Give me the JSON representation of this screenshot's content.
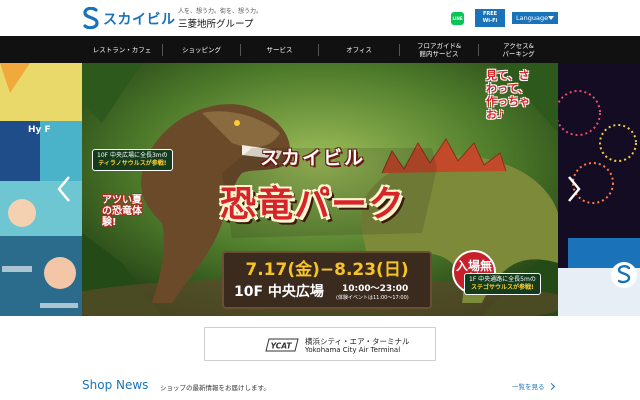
{
  "header": {
    "logo_text": "スカイビル",
    "tagline": "人を、想う力。街を、想う力。",
    "group_name": "三菱地所グループ",
    "line_label": "LINE",
    "wifi_line1": "FREE",
    "wifi_line2": "Wi-Fi",
    "language_label": "Language",
    "brand_color": "#1a73b9"
  },
  "nav": {
    "items": [
      {
        "label": "レストラン・カフェ"
      },
      {
        "label": "ショッピング"
      },
      {
        "label": "サービス"
      },
      {
        "label": "オフィス"
      },
      {
        "label": "フロアガイド&\n館内サービス"
      },
      {
        "label": "アクセス&\nパーキング"
      }
    ]
  },
  "hero": {
    "side_left_text": "Hy F",
    "banner_title_1": "スカイビル",
    "banner_title_2": "恐竜パーク",
    "headline_vertical": "アツい夏の恐竜体験!",
    "top_left_note": "10F 中央広場に全長3mの",
    "top_left_note_hl": "ティラノサウルスが参戦!",
    "top_right_text": "見て、さわって、作っちゃお♪",
    "right_note": "1F 中央通路に全長5mの",
    "right_note_hl": "ステゴサウルスが参戦!",
    "date_range": "7.17(金)−8.23(日)",
    "venue": "10F 中央広場",
    "hours": "10:00〜23:00",
    "hours_note": "(体験イベントは11:00〜17:00)",
    "admission": "入場無料"
  },
  "ycat": {
    "logo_text": "YCAT",
    "name_jp": "横浜シティ・エア・ターミナル",
    "name_en": "Yokohama City Air Terminal"
  },
  "news": {
    "title": "Shop News",
    "description": "ショップの最新情報をお届けします。",
    "link_label": "一覧を見る"
  }
}
